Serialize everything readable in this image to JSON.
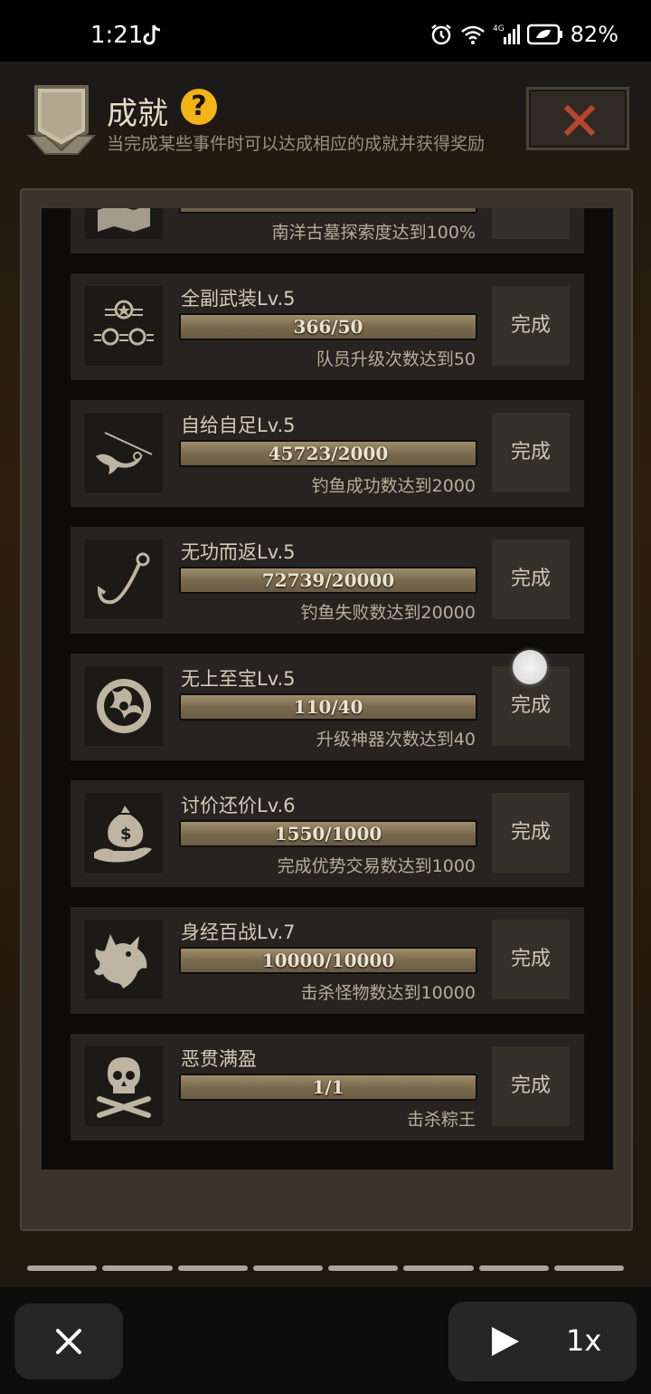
{
  "status_bar": {
    "time": "1:21",
    "battery": "82%",
    "network": "4G"
  },
  "header": {
    "title": "成就",
    "help_symbol": "?",
    "subtitle": "当完成某些事件时可以达成相应的成就并获得奖励"
  },
  "achievements": [
    {
      "name": "",
      "progress_text": "",
      "progress": 1.0,
      "desc": "南洋古墓探索度达到100%",
      "button": "",
      "icon": "map-icon"
    },
    {
      "name": "全副武装Lv.5",
      "progress_text": "366/50",
      "progress": 1.0,
      "desc": "队员升级次数达到50",
      "button": "完成",
      "icon": "rank-stars-icon"
    },
    {
      "name": "自给自足Lv.5",
      "progress_text": "45723/2000",
      "progress": 1.0,
      "desc": "钓鱼成功数达到2000",
      "button": "完成",
      "icon": "fish-icon"
    },
    {
      "name": "无功而返Lv.5",
      "progress_text": "72739/20000",
      "progress": 1.0,
      "desc": "钓鱼失败数达到20000",
      "button": "完成",
      "icon": "fishhook-icon"
    },
    {
      "name": "无上至宝Lv.5",
      "progress_text": "110/40",
      "progress": 1.0,
      "desc": "升级神器次数达到40",
      "button": "完成",
      "icon": "artifact-icon"
    },
    {
      "name": "讨价还价Lv.6",
      "progress_text": "1550/1000",
      "progress": 1.0,
      "desc": "完成优势交易数达到1000",
      "button": "完成",
      "icon": "money-bag-icon"
    },
    {
      "name": "身经百战Lv.7",
      "progress_text": "10000/10000",
      "progress": 1.0,
      "desc": "击杀怪物数达到10000",
      "button": "完成",
      "icon": "wolf-head-icon"
    },
    {
      "name": "恶贯满盈",
      "progress_text": "1/1",
      "progress": 1.0,
      "desc": "击杀粽王",
      "button": "完成",
      "icon": "skull-crossbones-icon"
    }
  ],
  "player_controls": {
    "speed_label": "1x",
    "segments": 8
  },
  "colors": {
    "help_badge": "#f2b317",
    "close_x": "#b8452f",
    "bar": "#8a785a"
  }
}
